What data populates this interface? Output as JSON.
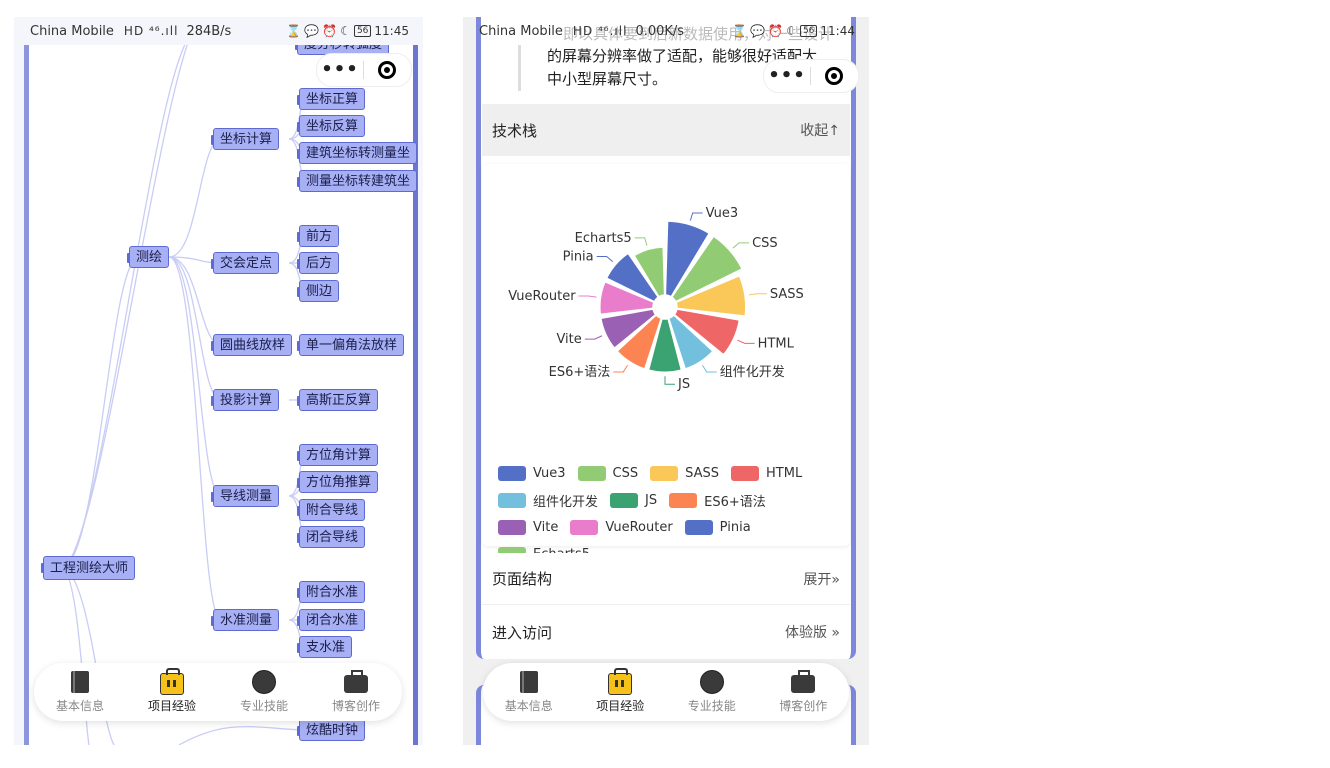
{
  "status_left": {
    "carrier": "China Mobile",
    "network": "HD ⁴⁶.ıll",
    "speed": "284B/s",
    "battery": "56",
    "time": "11:45"
  },
  "status_right": {
    "carrier": "China Mobile",
    "network": "HD ⁴⁶.ıll",
    "speed": "0.00K/s",
    "battery": "56",
    "time": "11:44"
  },
  "capsule": {
    "more": "•••"
  },
  "mindmap": {
    "root": "工程测绘大师",
    "top_partial": "度分秒转弧度",
    "level1": "测绘",
    "groups": [
      {
        "label": "坐标计算",
        "children": [
          "坐标正算",
          "坐标反算",
          "建筑坐标转测量坐",
          "测量坐标转建筑坐"
        ]
      },
      {
        "label": "交会定点",
        "children": [
          "前方",
          "后方",
          "侧边"
        ]
      },
      {
        "label": "圆曲线放样",
        "children": [
          "单一偏角法放样"
        ]
      },
      {
        "label": "投影计算",
        "children": [
          "高斯正反算"
        ]
      },
      {
        "label": "导线测量",
        "children": [
          "方位角计算",
          "方位角推算",
          "附合导线",
          "闭合导线"
        ]
      },
      {
        "label": "水准测量",
        "children": [
          "附合水准",
          "闭合水准",
          "支水准"
        ]
      }
    ],
    "bottom_partial": "炫酷时钟"
  },
  "tabbar": {
    "tabs": [
      {
        "label": "基本信息",
        "icon": "book-icon"
      },
      {
        "label": "项目经验",
        "icon": "briefcase-icon",
        "active": true
      },
      {
        "label": "专业技能",
        "icon": "ball-icon"
      },
      {
        "label": "博客创作",
        "icon": "box-icon"
      }
    ]
  },
  "detail": {
    "intro_ghost": "即以具体要到后新数据使用，对一些设计",
    "intro_line1": "的屏幕分辨率做了适配，能够很好适配大",
    "intro_line2": "中小型屏幕尺寸。",
    "tech_title": "技术栈",
    "tech_action": "收起↑",
    "structure_title": "页面结构",
    "structure_action": "展开»",
    "visit_title": "进入访问",
    "visit_action": "体验版 »"
  },
  "chart_data": {
    "type": "pie",
    "style": "rose",
    "categories": [
      "Vue3",
      "CSS",
      "SASS",
      "HTML",
      "组件化开发",
      "JS",
      "ES6+语法",
      "Vite",
      "VueRouter",
      "Pinia",
      "Echarts5"
    ],
    "values": [
      10,
      10,
      9,
      8,
      6,
      6,
      6,
      6,
      6,
      6,
      5
    ],
    "colors": [
      "#5470c6",
      "#91cc75",
      "#fac858",
      "#ee6666",
      "#73c0de",
      "#3ba272",
      "#fc8452",
      "#9a60b4",
      "#ea7ccc",
      "#5470c6",
      "#91cc75"
    ],
    "legend_position": "bottom",
    "title": ""
  }
}
